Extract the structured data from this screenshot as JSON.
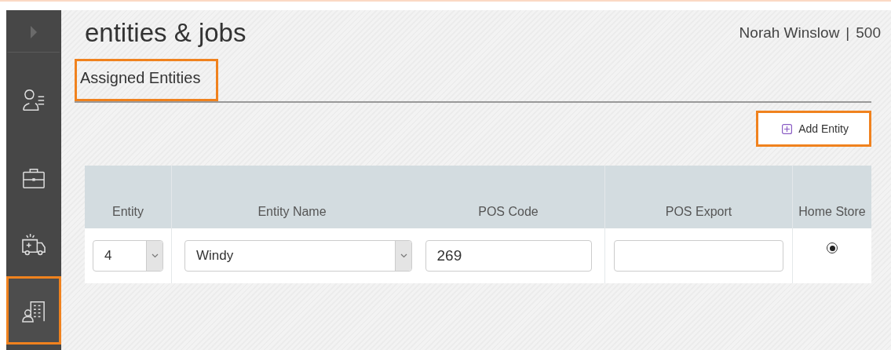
{
  "sidebar": {
    "items": [
      {
        "kind": "expand",
        "selected": false
      },
      {
        "kind": "person-list",
        "selected": false
      },
      {
        "kind": "briefcase",
        "selected": false
      },
      {
        "kind": "ambulance",
        "selected": false
      },
      {
        "kind": "building-person",
        "selected": true
      }
    ]
  },
  "header": {
    "title": "entities & jobs",
    "user": "Norah Winslow",
    "separator": "|",
    "store": "500"
  },
  "tabs": [
    {
      "label": "Assigned Entities",
      "selected": true
    }
  ],
  "add_button": {
    "label": "Add Entity"
  },
  "table": {
    "columns": [
      "Entity",
      "Entity Name",
      "POS Code",
      "POS Export",
      "Home Store"
    ],
    "rows": [
      {
        "entity": "4",
        "entity_name": "Windy",
        "pos_code": "269",
        "pos_export": "",
        "home_store": {
          "selected": true
        }
      }
    ]
  }
}
